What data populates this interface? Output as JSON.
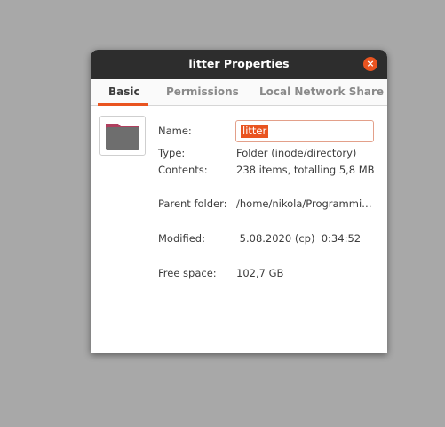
{
  "window": {
    "title": "litter Properties",
    "close_icon": "×"
  },
  "tabs": [
    {
      "label": "Basic",
      "active": true
    },
    {
      "label": "Permissions",
      "active": false
    },
    {
      "label": "Local Network Share",
      "active": false
    }
  ],
  "basic": {
    "name_label": "Name:",
    "name_value": "litter",
    "type_label": "Type:",
    "type_value": "Folder (inode/directory)",
    "contents_label": "Contents:",
    "contents_value": "238 items, totalling 5,8 MB",
    "parent_label": "Parent folder:",
    "parent_value": "/home/nikola/Programmi…",
    "modified_label": "Modified:",
    "modified_value": " 5.08.2020 (cp)  0:34:52",
    "free_space_label": "Free space:",
    "free_space_value": "102,7 GB"
  },
  "colors": {
    "accent": "#e95420",
    "titlebar": "#2d2d2d",
    "folder_body": "#6e6e6e",
    "folder_tab": "#b0405f"
  }
}
